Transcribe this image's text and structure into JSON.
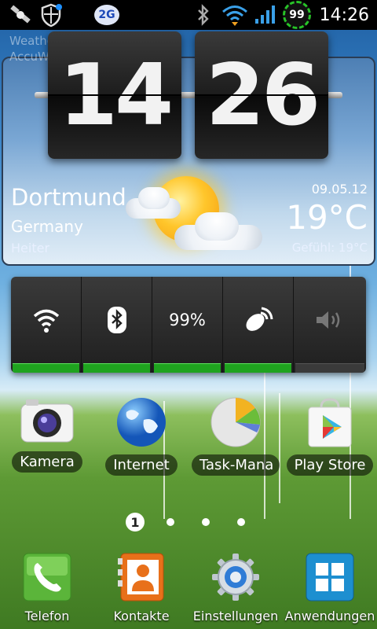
{
  "status_bar": {
    "network_type": "2G",
    "battery_percent": "99",
    "time": "14:26",
    "icons": [
      "satellite-icon",
      "shield-icon",
      "bluetooth-icon",
      "wifi-icon",
      "signal-icon"
    ]
  },
  "weather_widget": {
    "source_text": "Weather information from AccuWeather.com",
    "clock_hours": "14",
    "clock_minutes": "26",
    "city": "Dortmund",
    "country": "Germany",
    "condition": "Heiter",
    "date": "09.05.12",
    "temperature": "19°C",
    "feels_like": "Gefühl: 19°C"
  },
  "power_widget": {
    "battery_label": "99%",
    "toggles": [
      {
        "name": "wifi-toggle",
        "icon": "wifi-icon",
        "on": true
      },
      {
        "name": "bluetooth-toggle",
        "icon": "bluetooth-icon",
        "on": true
      },
      {
        "name": "battery-toggle",
        "icon": "battery-text",
        "on": true
      },
      {
        "name": "gps-toggle",
        "icon": "gps-icon",
        "on": true
      },
      {
        "name": "sound-toggle",
        "icon": "volume-icon",
        "on": false
      }
    ]
  },
  "apps": [
    {
      "label": "Kamera",
      "icon": "camera-icon"
    },
    {
      "label": "Internet",
      "icon": "globe-icon"
    },
    {
      "label": "Task-Mana",
      "icon": "pie-chart-icon"
    },
    {
      "label": "Play Store",
      "icon": "play-store-icon"
    }
  ],
  "page_indicator": {
    "current": "1",
    "total": 4
  },
  "dock": [
    {
      "label": "Telefon",
      "icon": "phone-icon"
    },
    {
      "label": "Kontakte",
      "icon": "contacts-icon"
    },
    {
      "label": "Einstellungen",
      "icon": "gear-icon"
    },
    {
      "label": "Anwendungen",
      "icon": "apps-grid-icon"
    }
  ],
  "colors": {
    "indicator_green": "#1fa31f",
    "status_bar_bg": "#000000"
  }
}
